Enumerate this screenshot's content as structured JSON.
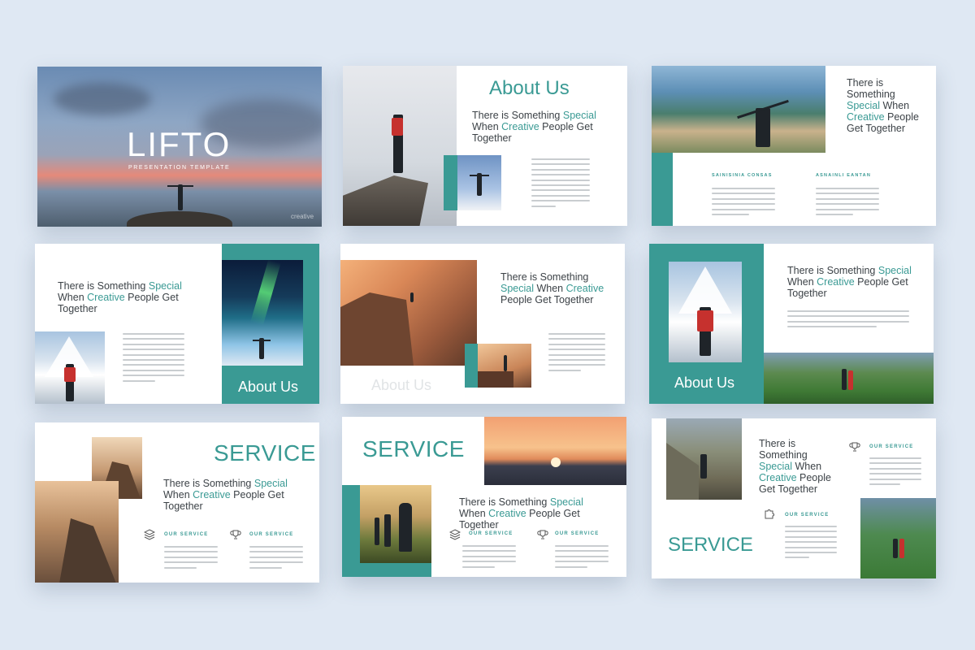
{
  "colors": {
    "accent": "#3a9a94",
    "background": "#dfe8f3",
    "text": "#3c4247"
  },
  "slide1": {
    "title": "LIFTO",
    "subtitle": "PRESENTATION TEMPLATE",
    "watermark": "creative"
  },
  "slide2": {
    "title": "About Us",
    "headline": {
      "p1": "There is Something ",
      "hl1": "Special",
      "p2": " When ",
      "hl2": "Creative",
      "p3": " People Get Together"
    }
  },
  "slide3": {
    "headline": {
      "p1": "There is Something ",
      "hl1": "Special",
      "p2": " When ",
      "hl2": "Creative",
      "p3": " People Get Together"
    },
    "col1_heading": "SAINISINIA CONSAS",
    "col2_heading": "ASNAINLI EANTAN"
  },
  "slide4": {
    "title": "About Us",
    "headline": {
      "p1": "There is Something ",
      "hl1": "Special",
      "p2": " When ",
      "hl2": "Creative",
      "p3": " People Get Together"
    }
  },
  "slide5": {
    "title": "About Us",
    "headline": {
      "p1": "There is Something ",
      "hl1": "Special",
      "p2": " When ",
      "hl2": "Creative",
      "p3": " People Get Together"
    }
  },
  "slide6": {
    "title": "About Us",
    "headline": {
      "p1": "There is Something ",
      "hl1": "Special",
      "p2": " When ",
      "hl2": "Creative",
      "p3": " People Get Together"
    }
  },
  "slide7": {
    "title": "SERVICE",
    "headline": {
      "p1": "There is Something ",
      "hl1": "Special",
      "p2": " When ",
      "hl2": "Creative",
      "p3": " People Get Together"
    },
    "sub1": "OUR SERVICE",
    "sub2": "OUR SERVICE"
  },
  "slide8": {
    "title": "SERVICE",
    "headline": {
      "p1": "There is Something ",
      "hl1": "Special",
      "p2": " When ",
      "hl2": "Creative",
      "p3": " People Get Together"
    },
    "sub1": "OUR SERVICE",
    "sub2": "OUR SERVICE"
  },
  "slide9": {
    "title": "SERVICE",
    "headline": {
      "p1": "There is Something ",
      "hl1": "Special",
      "p2": " When ",
      "hl2": "Creative",
      "p3": " People Get Together"
    },
    "sub1": "OUR SERVICE",
    "sub2": "OUR SERVICE"
  },
  "icons": [
    "layers-icon",
    "trophy-icon",
    "puzzle-icon"
  ]
}
